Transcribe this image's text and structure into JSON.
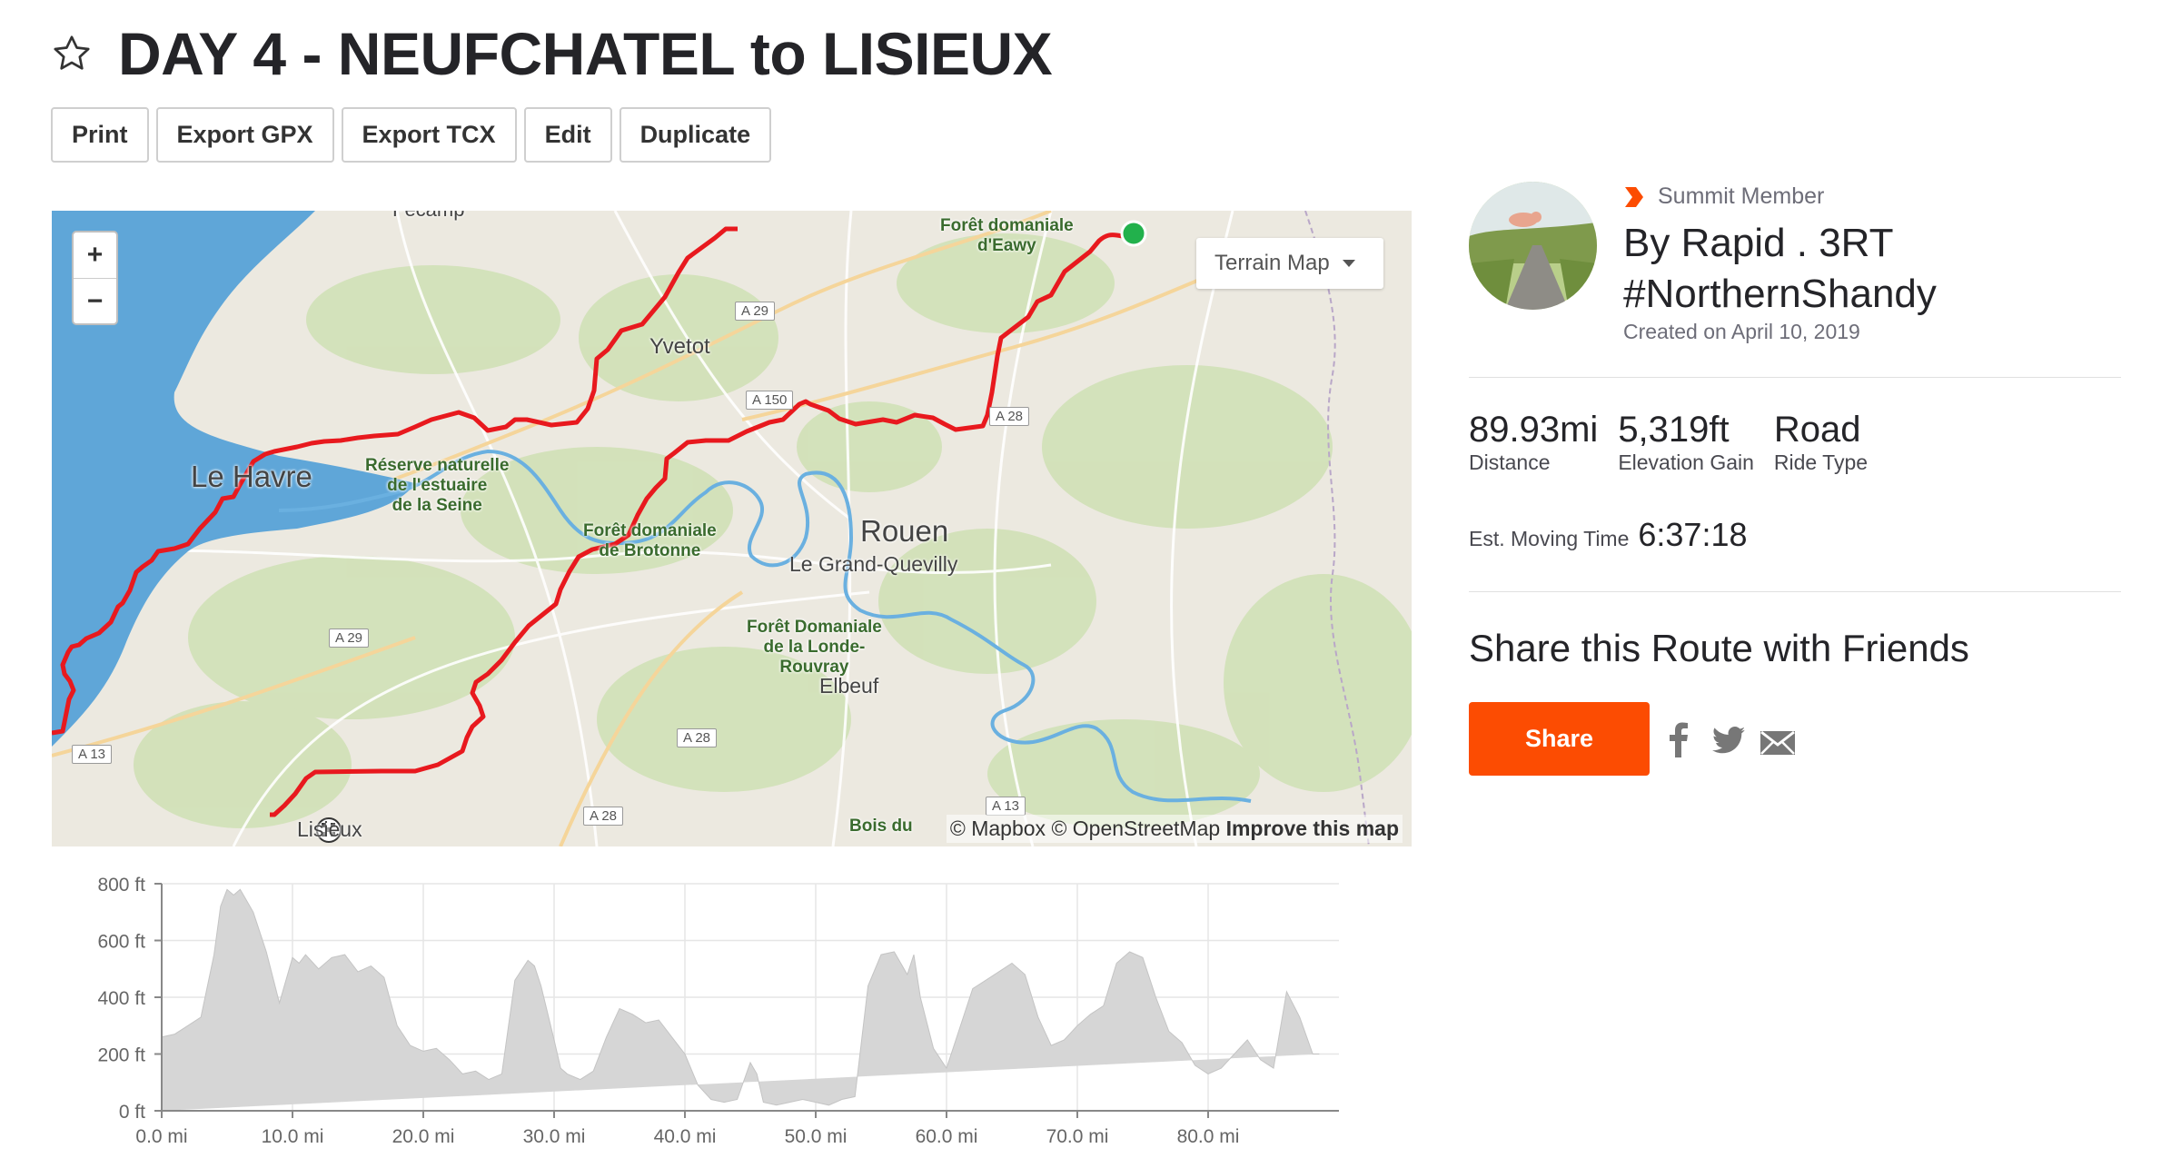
{
  "title": "DAY 4 - NEUFCHATEL to LISIEUX",
  "actions": [
    "Print",
    "Export GPX",
    "Export TCX",
    "Edit",
    "Duplicate"
  ],
  "map": {
    "zoom_in": "+",
    "zoom_out": "−",
    "layer_select": "Terrain Map",
    "attribution": {
      "mapbox": "© Mapbox",
      "osm": "© OpenStreetMap",
      "improve": "Improve this map"
    },
    "labels": {
      "fecamp": "Fécamp",
      "foret_eawy": "Forêt domaniale\nd'Eawy",
      "yvetot": "Yvetot",
      "le_havre": "Le Havre",
      "reserve": "Réserve naturelle\nde l'estuaire\nde la Seine",
      "foret_brotonne": "Forêt domaniale\nde Brotonne",
      "rouen": "Rouen",
      "grand_quevilly": "Le Grand-Quevilly",
      "foret_londe": "Forêt Domaniale\nde la Londe-\nRouvray",
      "elbeuf": "Elbeuf",
      "lisieux": "Lisieux",
      "bois": "Bois du"
    },
    "roads": {
      "a29_top": "A 29",
      "a150": "A 150",
      "a28_east": "A 28",
      "a29_west": "A 29",
      "a13_west": "A 13",
      "a28_mid": "A 28",
      "a28_south": "A 28",
      "a13_south": "A 13"
    },
    "route_color": "#e8191e",
    "start_color": "#22b14c"
  },
  "profile": {
    "member_badge": "Summit Member",
    "owner": "By Rapid . 3RT #NorthernShandy",
    "created": "Created on April 10, 2019",
    "stats": [
      {
        "value": "89.93mi",
        "label": "Distance"
      },
      {
        "value": "5,319ft",
        "label": "Elevation Gain"
      },
      {
        "value": "Road",
        "label": "Ride Type"
      }
    ],
    "moving_label": "Est. Moving Time",
    "moving_value": "6:37:18"
  },
  "share": {
    "heading": "Share this Route with Friends",
    "button": "Share",
    "icons": [
      "facebook-icon",
      "twitter-icon",
      "email-icon"
    ]
  },
  "chart_data": {
    "type": "area",
    "xlabel": "",
    "ylabel": "",
    "x_unit": "mi",
    "y_unit": "ft",
    "xlim": [
      0,
      90
    ],
    "ylim": [
      0,
      800
    ],
    "x_ticks": [
      "0.0 mi",
      "10.0 mi",
      "20.0 mi",
      "30.0 mi",
      "40.0 mi",
      "50.0 mi",
      "60.0 mi",
      "70.0 mi",
      "80.0 mi"
    ],
    "y_ticks": [
      "0 ft",
      "200 ft",
      "400 ft",
      "600 ft",
      "800 ft"
    ],
    "grid": true,
    "fill_color": "#d6d6d6",
    "x": [
      0,
      1,
      2,
      3,
      4,
      4.5,
      5,
      5.5,
      6,
      6.5,
      7,
      8,
      9,
      10,
      10.5,
      11,
      12,
      13,
      14,
      15,
      16,
      17,
      18,
      19,
      20,
      21,
      22,
      23,
      24,
      25,
      26,
      27,
      28,
      28.5,
      29,
      30,
      30.5,
      31,
      32,
      33,
      34,
      35,
      36,
      37,
      38,
      39,
      40,
      41,
      42,
      43,
      44,
      45,
      45.5,
      46,
      47,
      48,
      49,
      50,
      51,
      52,
      53,
      54,
      55,
      56,
      57,
      57.5,
      58,
      59,
      60,
      61,
      62,
      63,
      64,
      65,
      66,
      67,
      68,
      69,
      70,
      71,
      72,
      73,
      74,
      75,
      76,
      77,
      78,
      79,
      80,
      81,
      82,
      83,
      84,
      85,
      86,
      87,
      88,
      88.5,
      89,
      89.9
    ],
    "y": [
      260,
      270,
      300,
      330,
      550,
      720,
      780,
      760,
      780,
      740,
      700,
      560,
      380,
      540,
      520,
      550,
      500,
      540,
      550,
      490,
      510,
      470,
      300,
      230,
      210,
      220,
      180,
      130,
      140,
      110,
      130,
      460,
      530,
      510,
      440,
      250,
      150,
      130,
      110,
      140,
      260,
      360,
      340,
      310,
      320,
      260,
      200,
      90,
      40,
      30,
      40,
      170,
      130,
      30,
      20,
      30,
      40,
      30,
      20,
      40,
      50,
      440,
      550,
      560,
      480,
      550,
      400,
      220,
      150,
      290,
      430,
      460,
      490,
      520,
      480,
      330,
      230,
      250,
      300,
      340,
      370,
      520,
      560,
      540,
      400,
      280,
      240,
      160,
      130,
      150,
      200,
      250,
      180,
      150,
      420,
      330,
      200,
      200
    ]
  }
}
